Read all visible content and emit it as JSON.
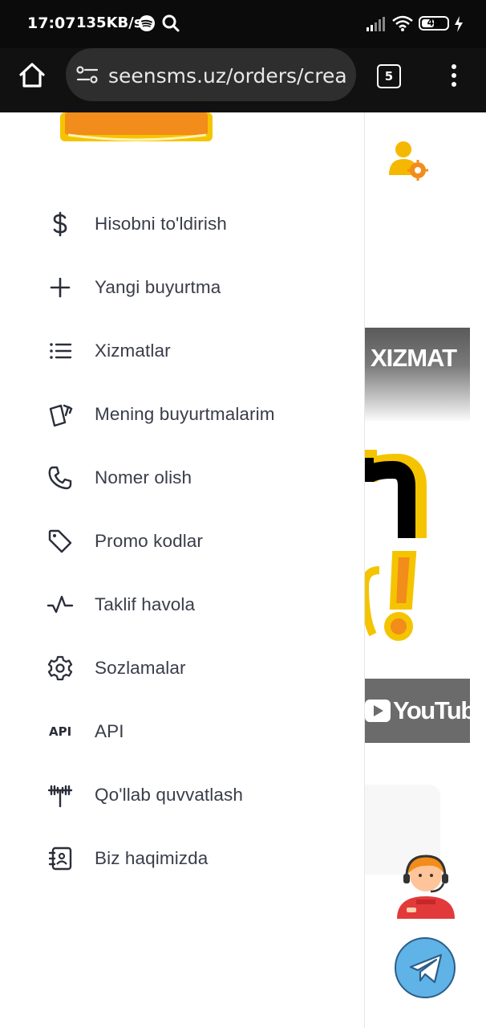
{
  "status_bar": {
    "time": "17:07",
    "speed": "135KB/s",
    "battery": "45"
  },
  "browser": {
    "url": "seensms.uz/orders/crea",
    "tab_count": "5"
  },
  "drawer": {
    "menu": [
      {
        "label": "Hisobni to'ldirish",
        "icon": "dollar-icon"
      },
      {
        "label": "Yangi buyurtma",
        "icon": "plus-icon"
      },
      {
        "label": "Xizmatlar",
        "icon": "list-icon"
      },
      {
        "label": "Mening buyurtmalarim",
        "icon": "cards-icon"
      },
      {
        "label": "Nomer olish",
        "icon": "phone-icon"
      },
      {
        "label": "Promo kodlar",
        "icon": "tag-icon"
      },
      {
        "label": "Taklif havola",
        "icon": "activity-icon"
      },
      {
        "label": "Sozlamalar",
        "icon": "gear-icon"
      },
      {
        "label": "API",
        "icon": "api-icon",
        "icon_text": "API"
      },
      {
        "label": "Qo'llab quvvatlash",
        "icon": "antenna-icon"
      },
      {
        "label": "Biz haqimizda",
        "icon": "contacts-icon"
      }
    ]
  },
  "background_page": {
    "banner_services": "XIZMAT",
    "banner_youtube": "YouTube"
  },
  "colors": {
    "status_bg": "#0b0b0b",
    "url_bg": "#2e2e2e",
    "menu_text": "#3a3d4a",
    "accent_yellow": "#f5c400",
    "accent_orange": "#f28c1a",
    "telegram_blue": "#5fb3e6"
  }
}
